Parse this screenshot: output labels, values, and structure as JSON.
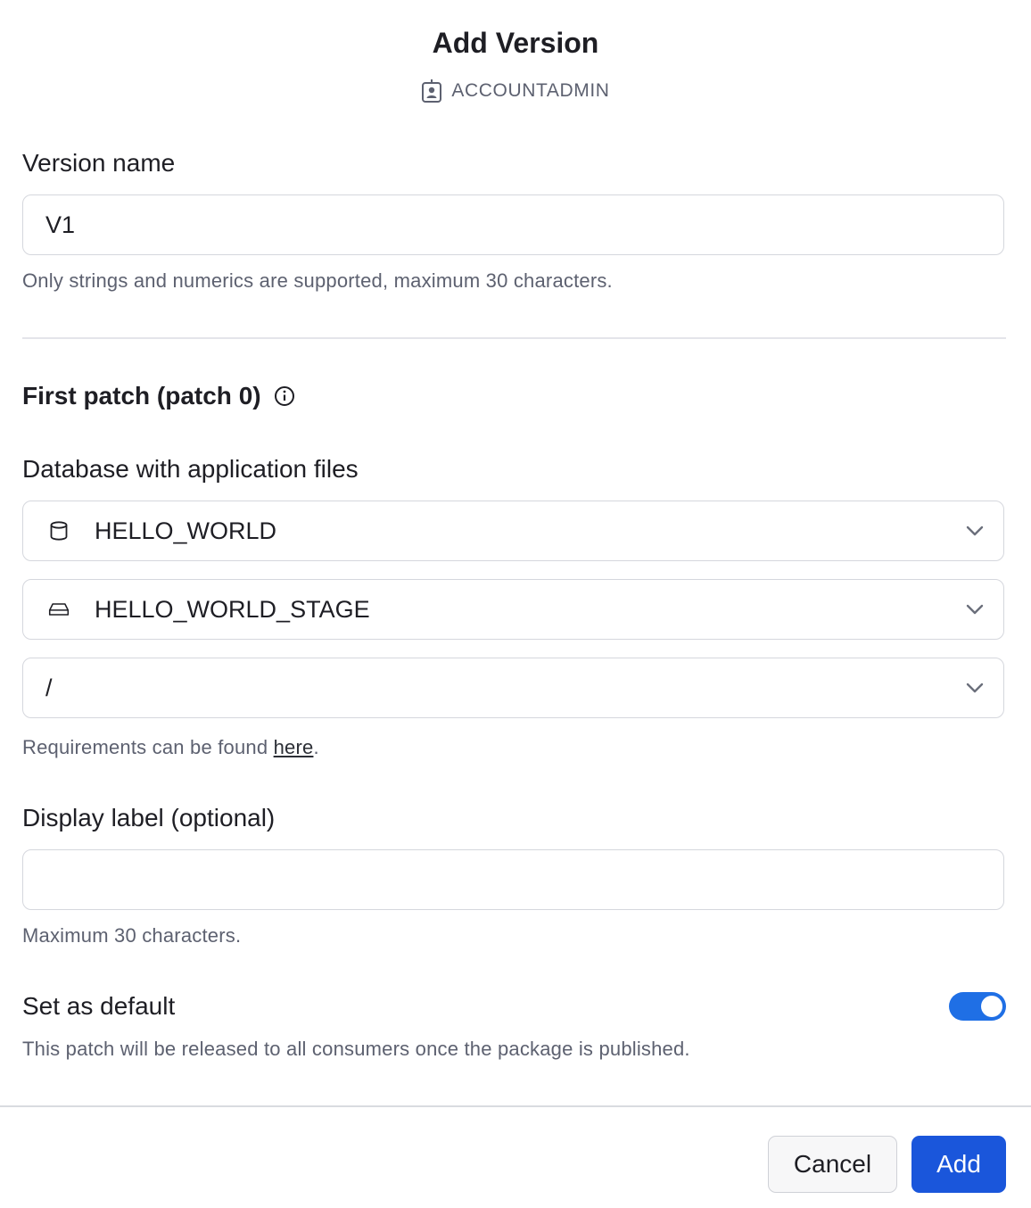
{
  "dialog": {
    "title": "Add Version",
    "role": "ACCOUNTADMIN"
  },
  "version_name": {
    "label": "Version name",
    "value": "V1",
    "help": "Only strings and numerics are supported, maximum 30 characters."
  },
  "first_patch": {
    "heading": "First patch (patch 0)"
  },
  "database": {
    "label": "Database with application files",
    "database_value": "HELLO_WORLD",
    "stage_value": "HELLO_WORLD_STAGE",
    "path_value": "/",
    "help_prefix": "Requirements can be found ",
    "help_link": "here",
    "help_suffix": "."
  },
  "display_label": {
    "label": "Display label (optional)",
    "value": "",
    "help": "Maximum 30 characters."
  },
  "default": {
    "label": "Set as default",
    "enabled": true,
    "help": "This patch will be released to all consumers once the package is published."
  },
  "footer": {
    "cancel_label": "Cancel",
    "add_label": "Add"
  },
  "colors": {
    "primary": "#1a56db",
    "toggle_on": "#1f6fe5"
  }
}
